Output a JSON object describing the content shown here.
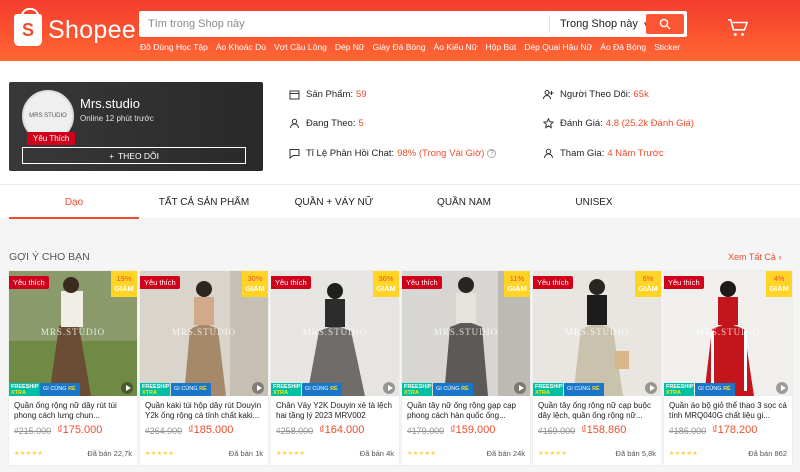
{
  "header": {
    "logo_text": "Shopee",
    "search_placeholder": "Tìm trong Shop này",
    "search_scope": "Trong Shop này",
    "suggestions": [
      "Đồ Dùng Học Tập",
      "Áo Khoác Dù",
      "Vợt Cầu Lông",
      "Dép Nữ",
      "Giày Đá Bóng",
      "Áo Kiểu Nữ",
      "Hộp Bút",
      "Dép Quai Hậu Nữ",
      "Áo Đá Bóng",
      "Sticker"
    ]
  },
  "shop": {
    "name": "Mrs.studio",
    "online": "Online 12 phút trước",
    "badge": "Yêu Thích",
    "follow_label": "THEO DÕI",
    "avatar_text": "MRS STUDIO",
    "stats": {
      "products_label": "Sản Phẩm:",
      "products_value": "59",
      "following_label": "Đang Theo:",
      "following_value": "5",
      "chat_label": "Tỉ Lệ Phản Hồi Chat:",
      "chat_value": "98% (Trong Vài Giờ)",
      "followers_label": "Người Theo Dõi:",
      "followers_value": "65k",
      "rating_label": "Đánh Giá:",
      "rating_value": "4.8 (25.2k Đánh Giá)",
      "joined_label": "Tham Gia:",
      "joined_value": "4 Năm Trước"
    }
  },
  "tabs": [
    "Dạo",
    "TẤT CẢ SẢN PHẨM",
    "QUẦN + VÁY NỮ",
    "QUẦN NAM",
    "UNISEX"
  ],
  "recommend": {
    "title": "GỢI Ý CHO BẠN",
    "see_all": "Xem Tất Cả"
  },
  "products": [
    {
      "title": "Quần ống rộng nữ dây rút túi phong cách lưng chun...",
      "old_price": "₫215.000",
      "price": "₫175.000",
      "discount": "19%",
      "sold": "Đã bán 22,7k"
    },
    {
      "title": "Quần kaki túi hộp dây rút Douyin Y2k ống rộng cá tính chất kaki...",
      "old_price": "₫264.000",
      "price": "₫185.000",
      "discount": "30%",
      "sold": "Đã bán 1k"
    },
    {
      "title": "Chân Váy Y2K Douyin xẻ tà lệch hai tầng lý 2023 MRV002",
      "old_price": "₫258.000",
      "price": "₫164.000",
      "discount": "36%",
      "sold": "Đã bán 4k"
    },
    {
      "title": "Quần tây nữ ống rộng gạp cạp phong cách hàn quốc ống...",
      "old_price": "₫179.000",
      "price": "₫159.000",
      "discount": "11%",
      "sold": "Đã bán 24k"
    },
    {
      "title": "Quần tây ống rộng nữ cạp buộc dây lệch, quần ống rộng nữ...",
      "old_price": "₫169.000",
      "price": "₫158.860",
      "discount": "6%",
      "sold": "Đã bán 5,8k"
    },
    {
      "title": "Quần áo bộ giỏ thể thao 3 sọc cá tính MRQ040G chất liệu gi...",
      "old_price": "₫186.000",
      "price": "₫178.200",
      "discount": "4%",
      "sold": "Đã bán 862"
    }
  ],
  "labels": {
    "ribbon": "Yêu thích",
    "discount_word": "GIẢM",
    "watermark": "MRS.STUDIO",
    "freeship": "FREESHIP",
    "xtra": "XTRA",
    "gicung": "GI CÙNG",
    "re": "RẺ",
    "stars": "★★★★★"
  },
  "colors": {
    "brand": "#ee4d2d",
    "badge_red": "#d0011b",
    "discount_yellow": "#ffd424",
    "freeship": "#00bfa5"
  }
}
